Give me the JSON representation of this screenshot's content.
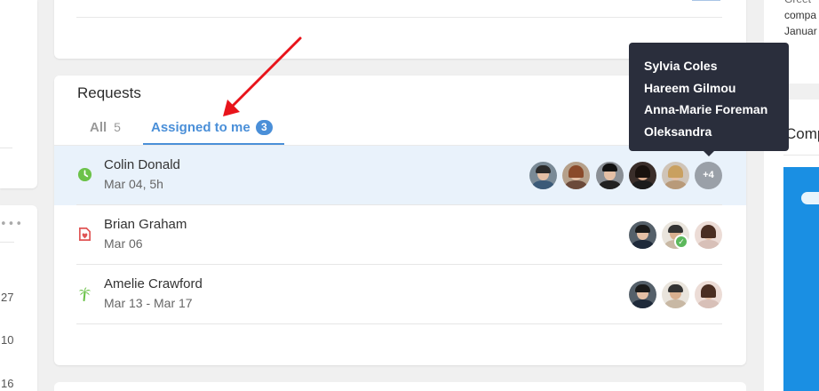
{
  "requests": {
    "title": "Requests",
    "tabs": [
      {
        "label": "All",
        "count": "5"
      },
      {
        "label": "Assigned to me",
        "count": "3"
      }
    ],
    "rows": [
      {
        "name": "Colin Donald",
        "date": "Mar 04, 5h",
        "icon": "clock-icon",
        "more_label": "+4"
      },
      {
        "name": "Brian Graham",
        "date": "Mar 06",
        "icon": "sick-leave-icon"
      },
      {
        "name": "Amelie Crawford",
        "date": "Mar 13 - Mar 17",
        "icon": "palm-tree-icon"
      }
    ]
  },
  "tooltip": {
    "names": [
      "Sylvia Coles",
      "Hareem Gilmou",
      "Anna-Marie Foreman",
      "Oleksandra"
    ]
  },
  "left_column": {
    "more_glyph": "•••",
    "dates": [
      "27",
      "10",
      "16"
    ]
  },
  "right_column": {
    "top_lines": [
      "compa",
      "Januar"
    ],
    "comp_title": "Comp"
  },
  "colors": {
    "accent": "#4a8fd8",
    "highlight_row": "#e9f2fb",
    "tooltip_bg": "#2a2e3c",
    "annotation_arrow": "#e8141b",
    "clock_icon": "#6cc24a",
    "sick_icon": "#e05555",
    "palm_icon": "#6cc24a"
  }
}
